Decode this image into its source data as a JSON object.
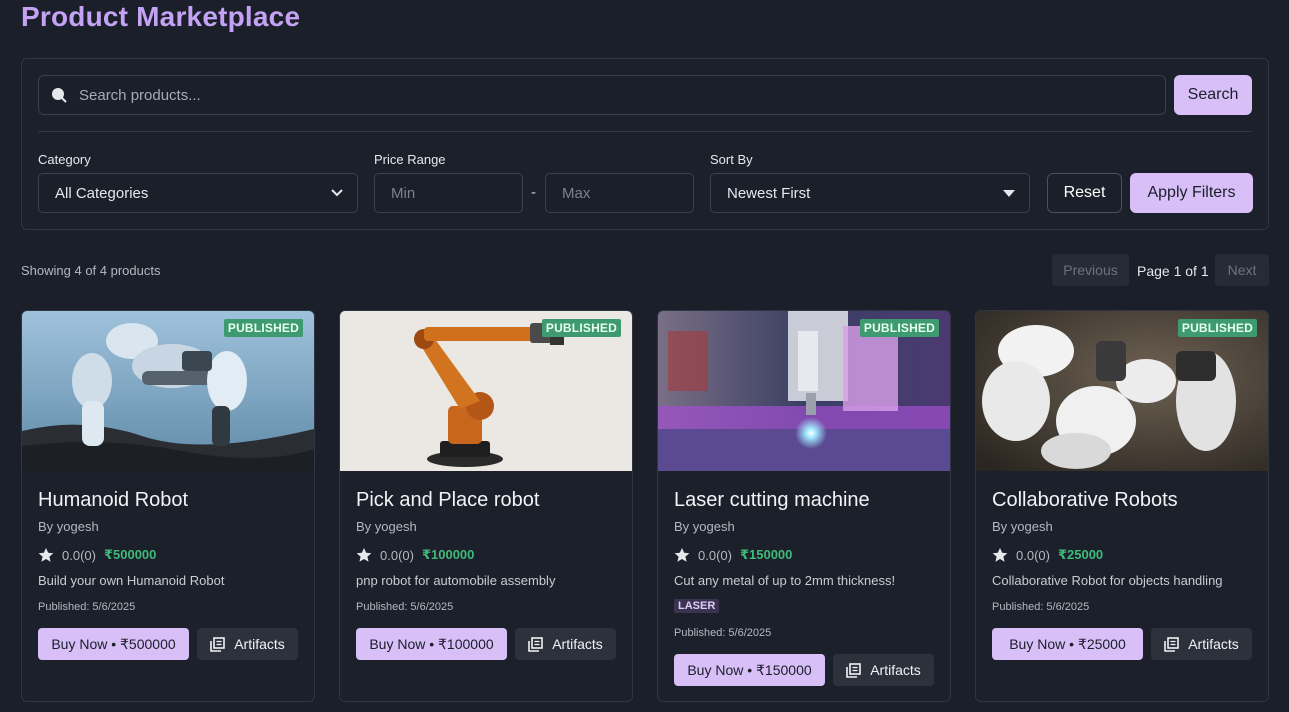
{
  "header": {
    "title": "Product Marketplace"
  },
  "search": {
    "placeholder": "Search products...",
    "button_label": "Search"
  },
  "filters": {
    "category_label": "Category",
    "category_value": "All Categories",
    "price_label": "Price Range",
    "min_placeholder": "Min",
    "max_placeholder": "Max",
    "price_separator": "-",
    "sort_label": "Sort By",
    "sort_value": "Newest First",
    "reset_label": "Reset",
    "apply_label": "Apply Filters"
  },
  "results": {
    "count_text": "Showing 4 of 4 products",
    "previous_label": "Previous",
    "page_info": "Page 1 of 1",
    "next_label": "Next"
  },
  "products": [
    {
      "title": "Humanoid Robot",
      "author": "By yogesh",
      "rating": "0.0(0)",
      "price": "₹500000",
      "description": "Build your own Humanoid Robot",
      "published": "Published: 5/6/2025",
      "status": "PUBLISHED",
      "buy_label": "Buy Now • ₹500000",
      "artifacts_label": "Artifacts",
      "tag": ""
    },
    {
      "title": "Pick and Place robot",
      "author": "By yogesh",
      "rating": "0.0(0)",
      "price": "₹100000",
      "description": "pnp robot for automobile assembly",
      "published": "Published: 5/6/2025",
      "status": "PUBLISHED",
      "buy_label": "Buy Now • ₹100000",
      "artifacts_label": "Artifacts",
      "tag": ""
    },
    {
      "title": "Laser cutting machine",
      "author": "By yogesh",
      "rating": "0.0(0)",
      "price": "₹150000",
      "description": "Cut any metal of up to 2mm thickness!",
      "published": "Published: 5/6/2025",
      "status": "PUBLISHED",
      "buy_label": "Buy Now • ₹150000",
      "artifacts_label": "Artifacts",
      "tag": "LASER"
    },
    {
      "title": "Collaborative Robots",
      "author": "By yogesh",
      "rating": "0.0(0)",
      "price": "₹25000",
      "description": "Collaborative Robot for objects handling",
      "published": "Published: 5/6/2025",
      "status": "PUBLISHED",
      "buy_label": "Buy Now • ₹25000",
      "artifacts_label": "Artifacts",
      "tag": ""
    }
  ],
  "colors": {
    "background": "#1a1f29",
    "accent": "#d8bff8",
    "title": "#c4a3f5",
    "price": "#3fba7a",
    "published_badge": "#3e9a6f"
  },
  "icons": {
    "search": "search-icon",
    "dropdown": "chevron-down-icon",
    "sort_dropdown": "caret-down-icon",
    "star": "star-icon",
    "artifacts": "library-icon"
  }
}
